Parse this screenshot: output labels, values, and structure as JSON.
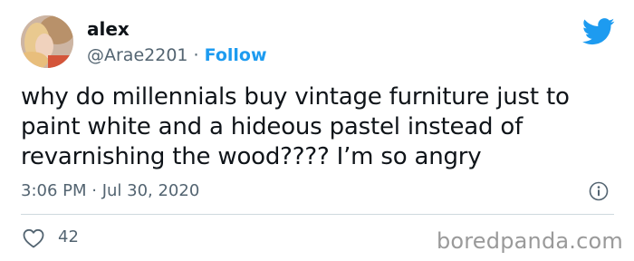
{
  "author": {
    "name": "alex",
    "handle": "@Arae2201",
    "separator": "·",
    "follow_label": "Follow"
  },
  "tweet": {
    "lines": [
      "why do millennials buy vintage furniture just to",
      "paint white and a hideous pastel instead of",
      "revarnishing the wood???? I’m so angry"
    ],
    "timestamp": "3:06 PM · Jul 30, 2020"
  },
  "actions": {
    "like_count": "42"
  },
  "watermark": "boredpanda.com",
  "icons": {
    "brand": "twitter-bird-icon",
    "info": "info-icon",
    "like": "heart-icon"
  },
  "colors": {
    "accent": "#1d9bf0",
    "text": "#0f1419",
    "muted": "#536471",
    "divider": "#cfd9de",
    "watermark": "#9a9a9a"
  }
}
